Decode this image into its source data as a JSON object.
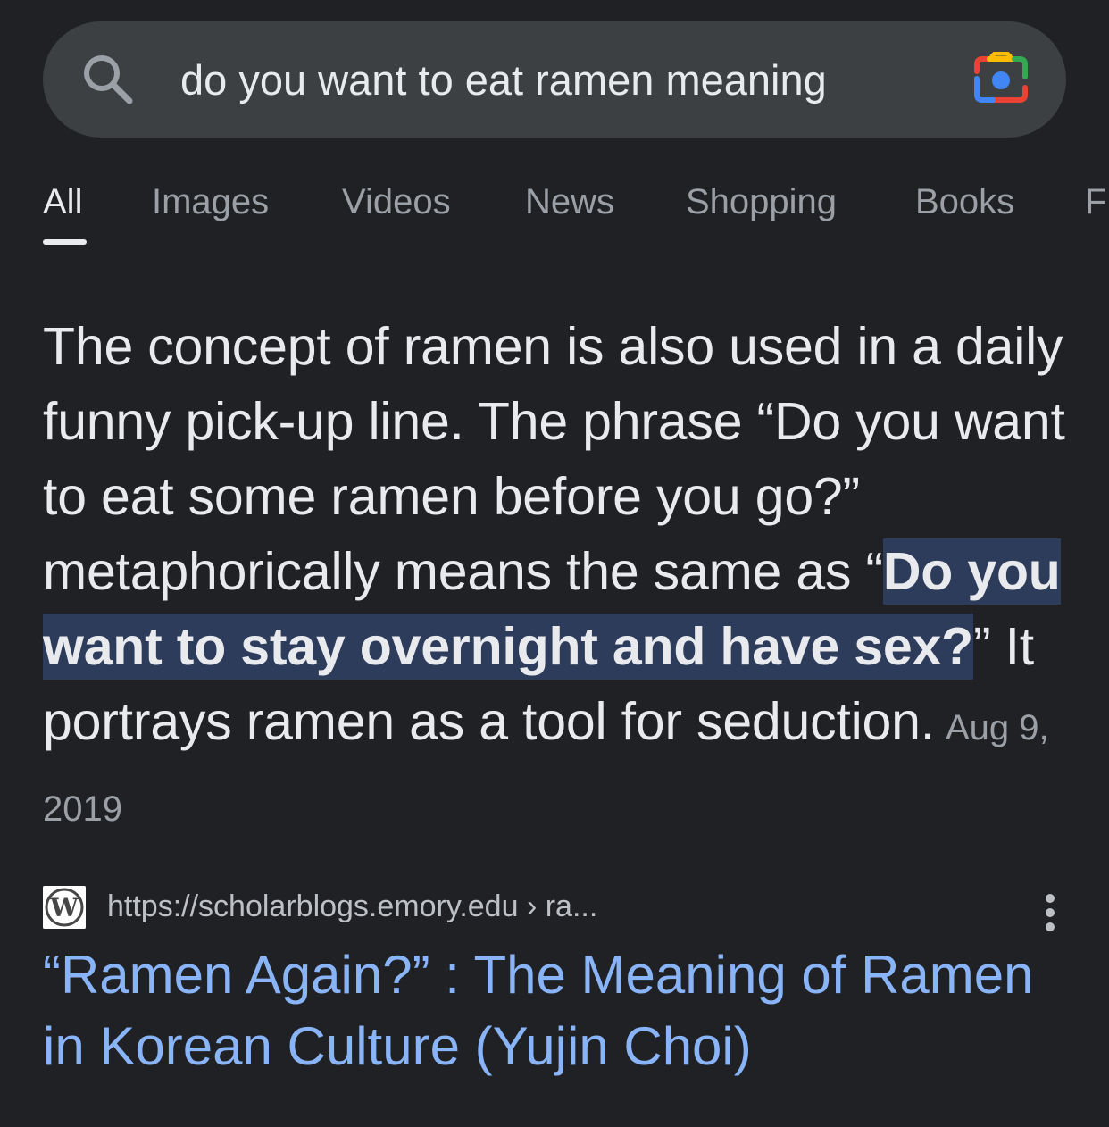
{
  "search": {
    "query": "do you want to eat ramen meaning",
    "search_icon": "search-icon",
    "lens_icon": "google-lens-icon"
  },
  "tabs": [
    {
      "label": "All",
      "active": true
    },
    {
      "label": "Images"
    },
    {
      "label": "Videos"
    },
    {
      "label": "News"
    },
    {
      "label": "Shopping"
    },
    {
      "label": "Books"
    },
    {
      "label": "F"
    }
  ],
  "snippet": {
    "text_before": "The concept of ramen is also used in a daily funny pick-up line. The phrase “Do you want to eat some ramen before you go?” metaphorically means the same as “",
    "highlight": "Do you want to stay overnight and have sex?",
    "text_after": "” It portrays ramen as a tool for seduction.",
    "date": "Aug 9, 2019"
  },
  "result": {
    "favicon": "wordpress-icon",
    "url": "https://scholarblogs.emory.edu › ra...",
    "more_icon": "more-vert-icon",
    "title": "“Ramen Again?” : The Meaning of Ramen in Korean Culture (Yujin Choi)"
  },
  "colors": {
    "background": "#202124",
    "search_bar": "#3c4043",
    "link": "#8ab4f8",
    "highlight": "#2e3c5b"
  }
}
